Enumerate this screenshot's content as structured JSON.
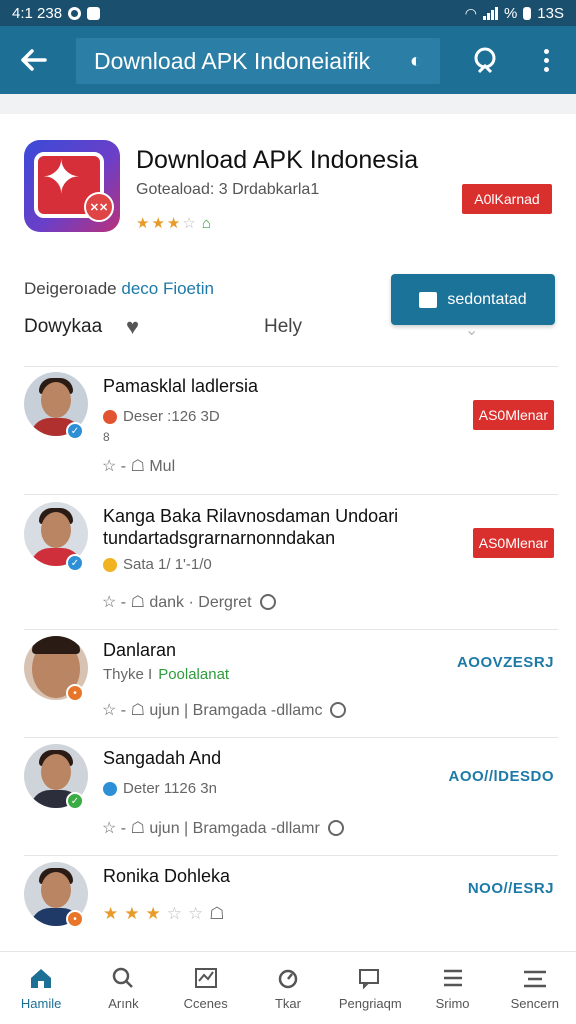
{
  "status_bar": {
    "time": "4:1 238",
    "battery": "13S",
    "signal": "%"
  },
  "app_bar": {
    "search_text": "Download APK Indoneiaifik",
    "icons": [
      "back-arrow-icon",
      "mic-icon",
      "profile-search-icon",
      "more-vertical-icon"
    ]
  },
  "app_header": {
    "title": "Download APK Indonesia",
    "subtitle": "Goteaload: 3 Drdabkarla1",
    "rating": 3.5,
    "action_chip": "A0lKarnad"
  },
  "meta": {
    "prefix": "Deigeroıade",
    "link": "deco Fioetin"
  },
  "primary_button": "sedontatad",
  "download_row": {
    "label": "Dowykaa",
    "help": "Hely"
  },
  "items": [
    {
      "title": "Pamasklal ladlersia",
      "sub": "Deser :126 3D",
      "extra": "8",
      "actions": "☆ - ☖ Mul",
      "chip": "AS0Mlenar",
      "badge_color": "#2d8fd5"
    },
    {
      "title": "Kanga Baka Rilavnosdaman Undoari",
      "title2": "tundartadsgrarnarnonndakan",
      "sub": "Sata 1/ 1'-1/0",
      "actions": "☆ - ☖  dank · Dergret",
      "chip": "AS0Mlenar",
      "badge_color": "#2d8fd5"
    },
    {
      "title": "Danlaran",
      "sub": "Thyke I",
      "sub_green": "Poolalanat",
      "actions": "☆ - ☖  ujun | Bramgada -dllamc",
      "link": "AOOVZESRJ",
      "badge_color": "#e8762a"
    },
    {
      "title": "Sangadah And",
      "sub": "Deter 1126 3n",
      "actions": "☆ - ☖  ujun | Bramgada -dllamr",
      "link": "AOO//lDESDO",
      "badge_color": "#3bab43"
    },
    {
      "title": "Ronika Dohleka",
      "rating": 3.5,
      "link": "NOO//ESRJ",
      "badge_color": "#e8762a"
    }
  ],
  "bottom_nav": [
    {
      "label": "Hamile",
      "icon": "home-icon",
      "active": true
    },
    {
      "label": "Arınk",
      "icon": "search-icon"
    },
    {
      "label": "Ccenes",
      "icon": "chart-icon"
    },
    {
      "label": "Tkar",
      "icon": "timer-icon"
    },
    {
      "label": "Pengriaqm",
      "icon": "chat-icon"
    },
    {
      "label": "Srimo",
      "icon": "list-icon"
    },
    {
      "label": "Sencern",
      "icon": "menu-icon"
    }
  ]
}
